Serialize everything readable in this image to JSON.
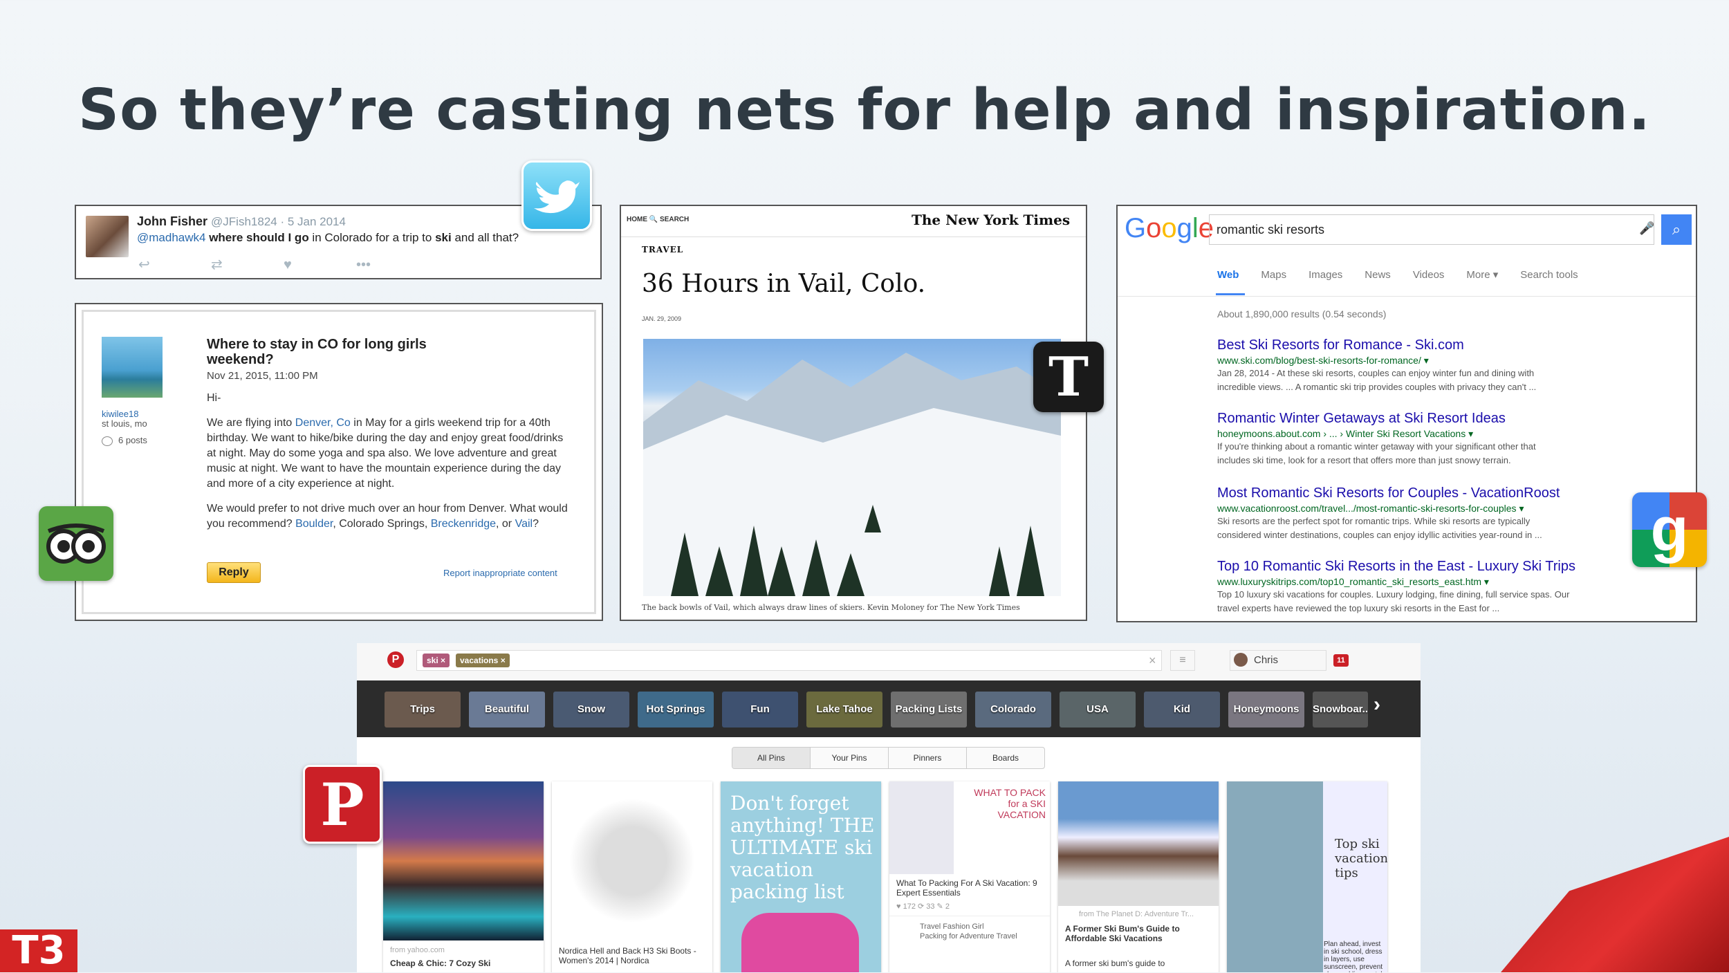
{
  "title": "So they’re casting nets for help and inspiration.",
  "tweet": {
    "name": "John Fisher",
    "handle_date": "@JFish1824 · 5 Jan 2014",
    "mention": "@madhawk4",
    "text_1": " where should I go",
    "text_2": " in Colorado for a trip to ",
    "text_bold": "ski",
    "text_3": " and all that?",
    "actions": [
      "↩",
      "⇄",
      "♥",
      "•••"
    ]
  },
  "forum": {
    "user": "kiwilee18",
    "location": "st louis, mo",
    "posts": "6 posts",
    "title": "Where to stay in CO for long girls weekend?",
    "date": "Nov 21, 2015, 11:00 PM",
    "greeting": "Hi-",
    "p1_a": "We are flying into ",
    "p1_link": "Denver, Co",
    "p1_b": " in May for a girls weekend trip for a 40th birthday. We want to hike/bike during the day and enjoy great food/drinks at night. May do some yoga and spa also. We love adventure and great music at night. We want to have the mountain experience during the day and more of a city experience at night.",
    "p2_a": "We would prefer to not drive much over an hour from Denver. What would you recommend? ",
    "p2_link1": "Boulder",
    "p2_b": ", Colorado Springs, ",
    "p2_link2": "Breckenridge",
    "p2_c": ", or ",
    "p2_link3": "Vail",
    "p2_d": "?",
    "reply": "Reply",
    "report": "Report inappropriate content"
  },
  "nyt": {
    "nav": "HOME   🔍 SEARCH",
    "logo": "The New York Times",
    "section": "TRAVEL",
    "headline": "36 Hours in Vail, Colo.",
    "date": "JAN. 29, 2009",
    "caption": "The back bowls of Vail, which always draw lines of skiers. Kevin Moloney for The New York Times",
    "badge": "T"
  },
  "google": {
    "logo": "Google",
    "query": "romantic ski resorts",
    "tabs": [
      "Web",
      "Maps",
      "Images",
      "News",
      "Videos",
      "More ▾",
      "Search tools"
    ],
    "stats": "About 1,890,000 results (0.54 seconds)",
    "results": [
      {
        "title": "Best Ski Resorts for Romance - Ski.com",
        "url": "www.ski.com/blog/best-ski-resorts-for-romance/ ▾",
        "s1": "Jan 28, 2014 - At these ski resorts, couples can enjoy winter fun and dining with",
        "s2": "incredible views. ... A romantic ski trip provides couples with privacy they can't ..."
      },
      {
        "title": "Romantic Winter Getaways at Ski Resort Ideas",
        "url": "honeymoons.about.com › ... › Winter Ski Resort Vacations ▾",
        "s1": "If you're thinking about a romantic winter getaway with your significant other that",
        "s2": "includes ski time, look for a resort that offers more than just snowy terrain."
      },
      {
        "title": "Most Romantic Ski Resorts for Couples - VacationRoost",
        "url": "www.vacationroost.com/travel.../most-romantic-ski-resorts-for-couples ▾",
        "s1": "Ski resorts are the perfect spot for romantic trips. While ski resorts are typically",
        "s2": "considered winter destinations, couples can enjoy idyllic activities year-round in ..."
      },
      {
        "title": "Top 10 Romantic Ski Resorts in the East - Luxury Ski Trips",
        "url": "www.luxuryskitrips.com/top10_romantic_ski_resorts_east.htm ▾",
        "s1": "Top 10 luxury ski vacations for couples. Luxury lodging, fine dining, full service spas. Our",
        "s2": "travel experts have reviewed the top luxury ski resorts in the East for ..."
      }
    ],
    "badge": "g"
  },
  "pinterest": {
    "logo": "P",
    "tags": [
      "ski ×",
      "vacations ×"
    ],
    "clear": "×",
    "user": "Chris",
    "notifications": "11",
    "categories": [
      {
        "label": "Trips",
        "color": "#6b5a4e"
      },
      {
        "label": "Beautiful",
        "color": "#6a7a95"
      },
      {
        "label": "Snow",
        "color": "#4a5a72"
      },
      {
        "label": "Hot Springs",
        "color": "#3f6a8a"
      },
      {
        "label": "Fun",
        "color": "#3e5170"
      },
      {
        "label": "Lake Tahoe",
        "color": "#6b6a3e"
      },
      {
        "label": "Packing Lists",
        "color": "#6f6f6f"
      },
      {
        "label": "Colorado",
        "color": "#5a6a7e"
      },
      {
        "label": "USA",
        "color": "#5a6568"
      },
      {
        "label": "Kid",
        "color": "#4d5a6e"
      },
      {
        "label": "Honeymoons",
        "color": "#7a7680"
      },
      {
        "label": "Snowboar...",
        "color": "#555"
      }
    ],
    "arrow": "›",
    "filters": [
      "All Pins",
      "Your Pins",
      "Pinners",
      "Boards"
    ],
    "pins": [
      {
        "source": "from yahoo.com",
        "caption": "Cheap & Chic: 7 Cozy Ski"
      },
      {
        "source": "",
        "caption": "Nordica Hell and Back H3 Ski Boots - Women's 2014 | Nordica"
      },
      {
        "source": "",
        "caption": "Don't forget anything! THE ULTIMATE ski vacation packing list"
      },
      {
        "source": "WHAT TO PACK for a SKI VACATION",
        "caption": "What To Packing For A Ski Vacation: 9 Expert Essentials",
        "stats": "♥ 172   ⟳ 33   ✎ 2",
        "pinner": "Travel Fashion Girl",
        "board": "Packing for Adventure Travel"
      },
      {
        "source": "from The Planet D: Adventure Tr...",
        "caption": "A Former Ski Bum's Guide to Affordable Ski Vacations",
        "more": "A former ski bum's guide to"
      },
      {
        "source": "Top ski vacation tips",
        "caption": "Plan ahead, invest in ski school, dress in layers, use sunscreen, prevent chapped lips, watch out"
      }
    ],
    "badge": "P"
  },
  "brand": {
    "t3": "T3"
  }
}
